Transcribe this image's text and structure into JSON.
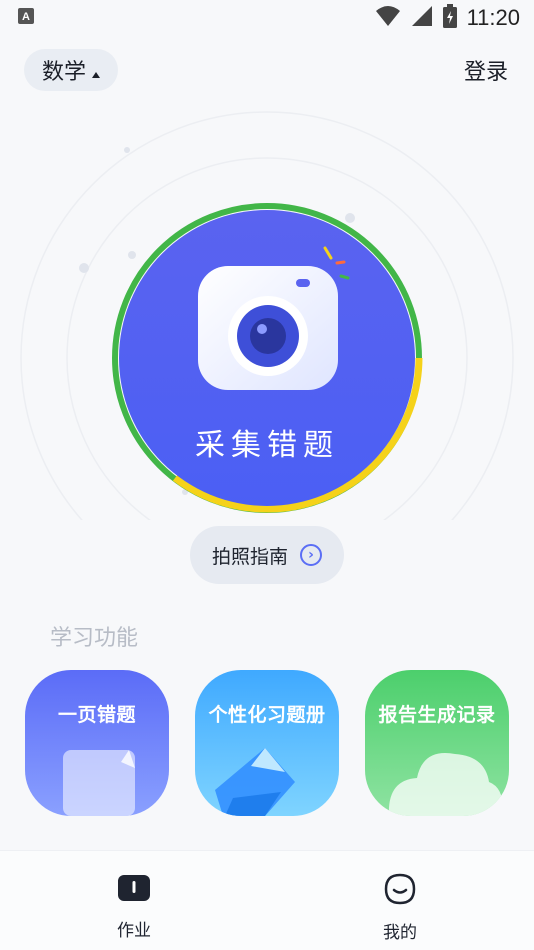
{
  "status_bar": {
    "time": "11:20",
    "app_icon": "a-letter-icon",
    "wifi_icon": "wifi-icon",
    "signal_icon": "signal-icon",
    "battery_icon": "battery-charging-icon"
  },
  "header": {
    "subject": "数学",
    "login": "登录"
  },
  "hero": {
    "button_label": "采集错题",
    "guide_label": "拍照指南",
    "colors": {
      "circle": "#5365f3",
      "ring_green": "#42b648",
      "ring_yellow": "#f5d21a",
      "ring_orange": "#ff6a3d"
    }
  },
  "features": {
    "title": "学习功能",
    "cards": [
      {
        "label": "一页错题",
        "color": "#6a79f8"
      },
      {
        "label": "个性化习题册",
        "color": "#53b8ff"
      },
      {
        "label": "报告生成记录",
        "color": "#5fd47c"
      }
    ]
  },
  "tabbar": {
    "items": [
      {
        "label": "作业",
        "icon": "book-icon"
      },
      {
        "label": "我的",
        "icon": "face-icon"
      }
    ]
  }
}
